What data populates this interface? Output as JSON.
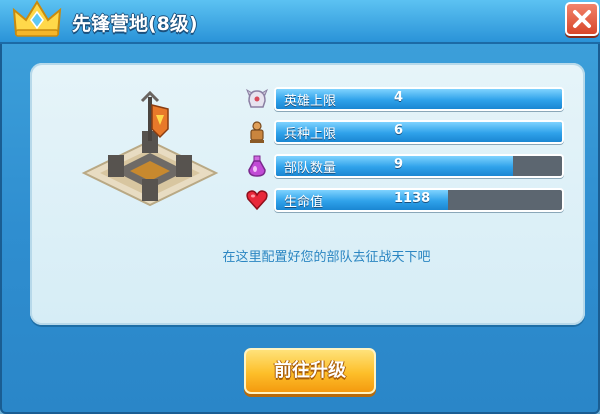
{
  "header": {
    "title": "先锋营地(8级)",
    "crown_icon": "crown-icon",
    "close_icon": "close-icon"
  },
  "building": {
    "icon": "vanguard-camp-building"
  },
  "stats": [
    {
      "label": "英雄上限",
      "value": "4",
      "icon": "hero-helmet-icon",
      "fill": 1.0
    },
    {
      "label": "兵种上限",
      "value": "6",
      "icon": "soldier-icon",
      "fill": 1.0
    },
    {
      "label": "部队数量",
      "value": "9",
      "icon": "potion-icon",
      "fill": 0.83
    },
    {
      "label": "生命值",
      "value": "1138",
      "icon": "heart-icon",
      "fill": 0.6
    }
  ],
  "description": "在这里配置好您的部队去征战天下吧",
  "upgrade_button": {
    "label": "前往升级"
  },
  "colors": {
    "header_blue": "#2a93d8",
    "bar_fill": "#2fa2ea",
    "bar_empty": "#5c6670",
    "button_gold": "#fdbf2a",
    "close_red": "#d8472a"
  }
}
